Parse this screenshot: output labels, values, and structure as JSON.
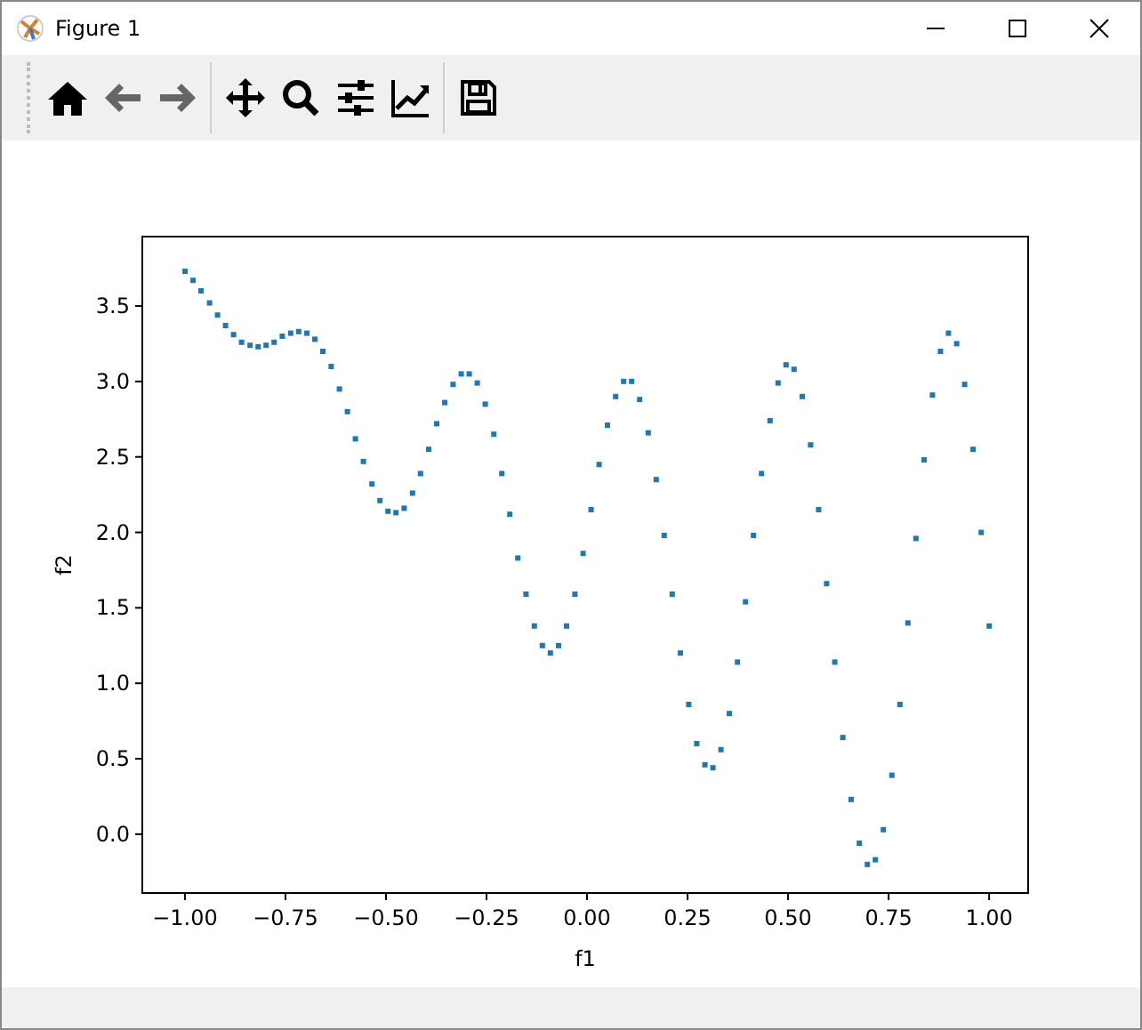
{
  "window": {
    "title": "Figure 1"
  },
  "toolbar": {
    "buttons": [
      {
        "disabled": false
      },
      {
        "disabled": true
      },
      {
        "disabled": true
      },
      {
        "disabled": false
      },
      {
        "disabled": false
      },
      {
        "disabled": false
      },
      {
        "disabled": false
      },
      {
        "disabled": false
      }
    ]
  },
  "figure": {
    "chart_data": {
      "type": "scatter",
      "xlabel": "f1",
      "ylabel": "f2",
      "x": [
        -1,
        -0.98,
        -0.96,
        -0.939,
        -0.919,
        -0.899,
        -0.879,
        -0.859,
        -0.838,
        -0.818,
        -0.798,
        -0.778,
        -0.758,
        -0.737,
        -0.717,
        -0.697,
        -0.677,
        -0.657,
        -0.636,
        -0.616,
        -0.596,
        -0.576,
        -0.556,
        -0.535,
        -0.515,
        -0.495,
        -0.475,
        -0.455,
        -0.434,
        -0.414,
        -0.394,
        -0.374,
        -0.354,
        -0.333,
        -0.313,
        -0.293,
        -0.273,
        -0.253,
        -0.232,
        -0.212,
        -0.192,
        -0.172,
        -0.152,
        -0.131,
        -0.111,
        -0.091,
        -0.071,
        -0.051,
        -0.03,
        -0.01,
        0.01,
        0.03,
        0.051,
        0.071,
        0.091,
        0.111,
        0.131,
        0.152,
        0.172,
        0.192,
        0.212,
        0.232,
        0.253,
        0.273,
        0.293,
        0.313,
        0.333,
        0.354,
        0.374,
        0.394,
        0.414,
        0.434,
        0.455,
        0.475,
        0.495,
        0.515,
        0.535,
        0.556,
        0.576,
        0.596,
        0.616,
        0.636,
        0.657,
        0.677,
        0.697,
        0.717,
        0.737,
        0.758,
        0.778,
        0.798,
        0.818,
        0.838,
        0.859,
        0.879,
        0.899,
        0.919,
        0.939,
        0.96,
        0.98,
        1
      ],
      "series": [
        {
          "color": "#1f77b4",
          "values": [
            3.73,
            3.67,
            3.6,
            3.52,
            3.44,
            3.37,
            3.31,
            3.26,
            3.24,
            3.23,
            3.24,
            3.26,
            3.3,
            3.32,
            3.33,
            3.32,
            3.28,
            3.2,
            3.1,
            2.95,
            2.8,
            2.62,
            2.47,
            2.32,
            2.21,
            2.14,
            2.13,
            2.16,
            2.26,
            2.39,
            2.55,
            2.72,
            2.86,
            2.98,
            3.05,
            3.05,
            2.99,
            2.85,
            2.65,
            2.39,
            2.12,
            1.83,
            1.59,
            1.38,
            1.25,
            1.2,
            1.25,
            1.38,
            1.59,
            1.86,
            2.15,
            2.45,
            2.71,
            2.9,
            3.0,
            3.0,
            2.88,
            2.66,
            2.35,
            1.98,
            1.59,
            1.2,
            0.86,
            0.6,
            0.46,
            0.44,
            0.56,
            0.8,
            1.14,
            1.54,
            1.98,
            2.39,
            2.74,
            2.99,
            3.11,
            3.08,
            2.9,
            2.58,
            2.15,
            1.66,
            1.14,
            0.64,
            0.23,
            -0.06,
            -0.2,
            -0.17,
            0.03,
            0.39,
            0.86,
            1.4,
            1.96,
            2.48,
            2.91,
            3.2,
            3.32,
            3.25,
            2.98,
            2.55,
            2.0,
            1.38
          ]
        }
      ],
      "xlim": [
        -1.106,
        1.097
      ],
      "ylim": [
        -0.39,
        3.96
      ],
      "xticks": [
        {
          "value": -1,
          "label": "−1.00"
        },
        {
          "value": -0.75,
          "label": "−0.75"
        },
        {
          "value": -0.5,
          "label": "−0.50"
        },
        {
          "value": -0.25,
          "label": "−0.25"
        },
        {
          "value": 0,
          "label": "0.00"
        },
        {
          "value": 0.25,
          "label": "0.25"
        },
        {
          "value": 0.5,
          "label": "0.50"
        },
        {
          "value": 0.75,
          "label": "0.75"
        },
        {
          "value": 1,
          "label": "1.00"
        }
      ],
      "yticks": [
        {
          "value": 0,
          "label": "0.0"
        },
        {
          "value": 0.5,
          "label": "0.5"
        },
        {
          "value": 1,
          "label": "1.0"
        },
        {
          "value": 1.5,
          "label": "1.5"
        },
        {
          "value": 2,
          "label": "2.0"
        },
        {
          "value": 2.5,
          "label": "2.5"
        },
        {
          "value": 3,
          "label": "3.0"
        },
        {
          "value": 3.5,
          "label": "3.5"
        }
      ]
    }
  }
}
